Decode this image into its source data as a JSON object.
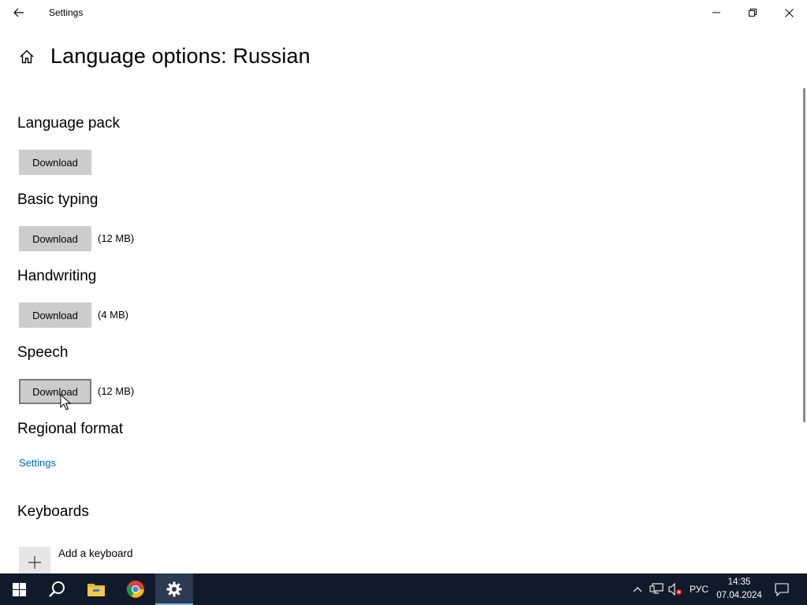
{
  "window": {
    "title": "Settings"
  },
  "page": {
    "title": "Language options: Russian"
  },
  "sections": {
    "language_pack": {
      "heading": "Language pack",
      "button": "Download"
    },
    "basic_typing": {
      "heading": "Basic typing",
      "button": "Download",
      "size": "(12 MB)"
    },
    "handwriting": {
      "heading": "Handwriting",
      "button": "Download",
      "size": "(4 MB)"
    },
    "speech": {
      "heading": "Speech",
      "button": "Download",
      "size": "(12 MB)"
    },
    "regional_format": {
      "heading": "Regional format",
      "link": "Settings"
    },
    "keyboards": {
      "heading": "Keyboards",
      "add_label": "Add a keyboard"
    }
  },
  "taskbar": {
    "language": "РУС",
    "time": "14:35",
    "date": "07.04.2024",
    "apps": [
      "start-icon",
      "search-icon",
      "file-explorer-icon",
      "chrome-icon",
      "settings-icon"
    ]
  },
  "colors": {
    "link": "#0067b8",
    "button_bg": "#cccccc",
    "taskbar_bg": "#101a2a"
  }
}
